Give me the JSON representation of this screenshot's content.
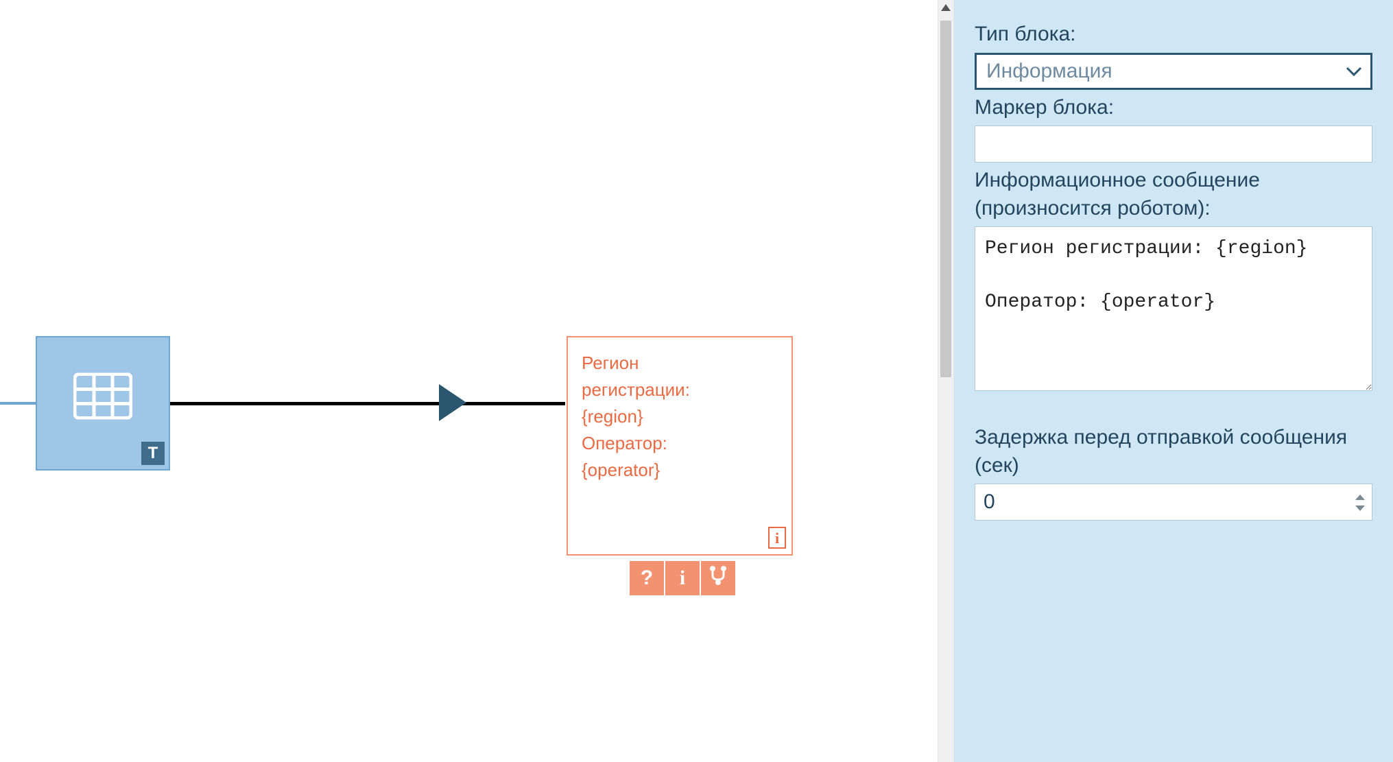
{
  "canvas": {
    "table_block": {
      "t_badge": "T"
    },
    "info_block": {
      "line1": "Регион",
      "line2": "регистрации:",
      "line3": "{region}",
      "line4": "Оператор:",
      "line5": "{operator}",
      "badge": "i"
    },
    "toolbar": {
      "help": "?",
      "info": "i"
    }
  },
  "panel": {
    "block_type_label": "Тип блока:",
    "block_type_value": "Информация",
    "block_marker_label": "Маркер блока:",
    "block_marker_value": "",
    "info_message_label": "Информационное сообщение (произносится роботом):",
    "info_message_value": "Регион регистрации: {region}\n\nОператор: {operator}",
    "delay_label": "Задержка перед отправкой сообщения (сек)",
    "delay_value": "0"
  }
}
